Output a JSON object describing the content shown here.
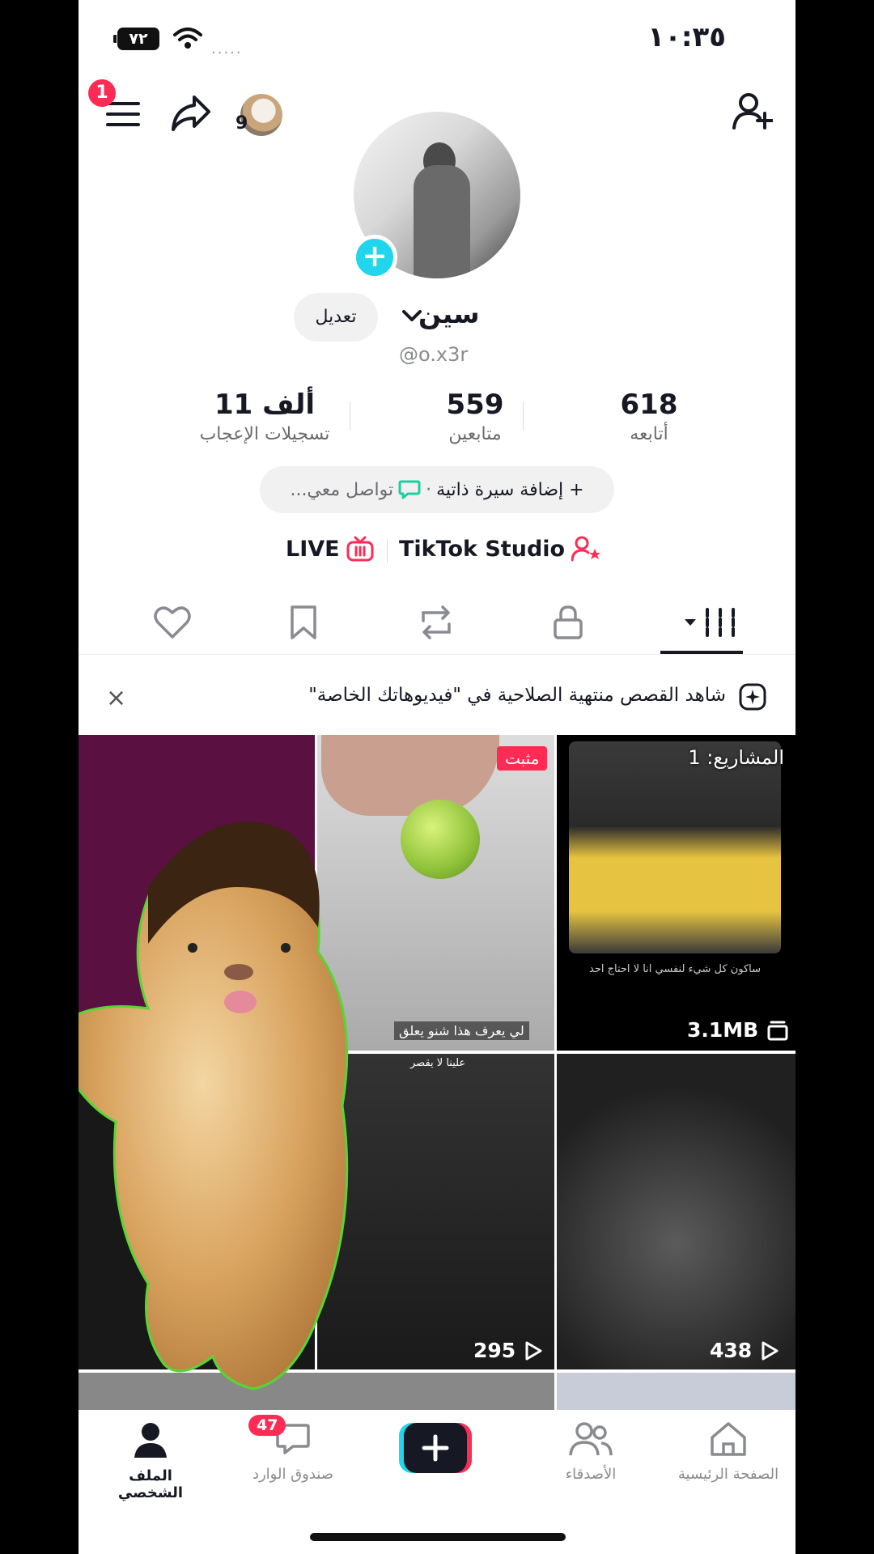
{
  "status_bar": {
    "time": "١٠:٣٥",
    "battery": "٧٢",
    "signal": "....."
  },
  "header": {
    "notification_count": "1",
    "friends_count": "9"
  },
  "profile": {
    "name": "سين",
    "handle": "@o.x3r",
    "edit_label": "تعديل",
    "stats": {
      "following": {
        "value": "618",
        "label": "أتابعه"
      },
      "followers": {
        "value": "559",
        "label": "متابعين"
      },
      "likes": {
        "value": "11 ألف",
        "label": "تسجيلات الإعجاب"
      }
    },
    "bio_add": "+ إضافة سيرة ذاتية",
    "bio_dot": "·",
    "contact": "تواصل معي...",
    "studio_label": "TikTok Studio",
    "live_label": "LIVE"
  },
  "banner": {
    "text": "شاهد القصص منتهية الصلاحية في \"فيديوهاتك الخاصة\"",
    "close": "×"
  },
  "grid": {
    "pinned_label": "مثبت",
    "drafts_label": "المشاريع: 1",
    "draft_caption": "ساكون كل شيء لنفسي انا لا احتاج احد",
    "draft_size": "3.1MB",
    "tile2_caption": "لي يعرف هذا شنو يعلق",
    "tile5_caption": "علينا لا يقصر",
    "tile5_views": "295",
    "tile6_views": "438"
  },
  "bottom_nav": {
    "home": "الصفحة الرئيسية",
    "friends": "الأصدقاء",
    "inbox": "صندوق الوارد",
    "inbox_badge": "47",
    "profile": "الملف الشخصي"
  },
  "colors": {
    "accent": "#fe2c55",
    "cyan": "#20d5ec",
    "green_chat": "#1dcf9f"
  }
}
